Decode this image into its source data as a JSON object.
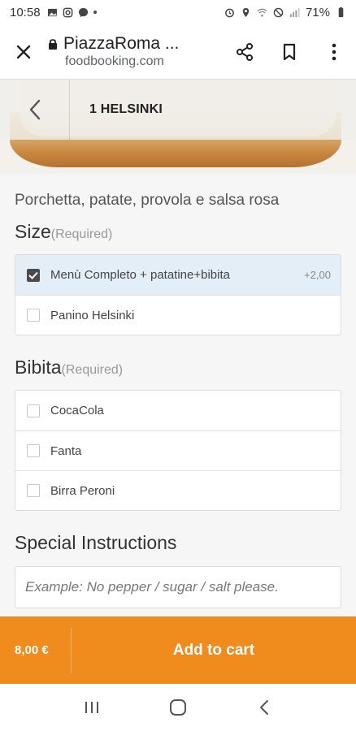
{
  "status_bar": {
    "time": "10:58",
    "battery": "71%",
    "left_icons": [
      "image-icon",
      "instagram-icon",
      "messenger-icon",
      "dot-icon"
    ],
    "right_icons": [
      "alarm-icon",
      "location-icon",
      "wifi-icon",
      "do-not-disturb-icon",
      "signal-icon",
      "battery-icon"
    ]
  },
  "browser": {
    "page_title": "PiazzaRoma ...",
    "domain": "foodbooking.com",
    "icons": [
      "close-icon",
      "lock-icon",
      "share-icon",
      "bookmark-icon",
      "more-vert-icon"
    ]
  },
  "item": {
    "title": "1 HELSINKI",
    "description": "Porchetta, patate, provola e salsa rosa"
  },
  "size_group": {
    "title": "Size",
    "required_label": "(Required)",
    "options": [
      {
        "label": "Menù Completo + patatine+bibita",
        "price": "+2,00",
        "checked": true
      },
      {
        "label": "Panino Helsinki",
        "price": "",
        "checked": false
      }
    ]
  },
  "drink_group": {
    "title": "Bibita",
    "required_label": "(Required)",
    "options": [
      {
        "label": "CocaCola",
        "checked": false
      },
      {
        "label": "Fanta",
        "checked": false
      },
      {
        "label": "Birra Peroni",
        "checked": false
      }
    ]
  },
  "special": {
    "title": "Special Instructions",
    "placeholder": "Example: No pepper / sugar / salt please.",
    "value": ""
  },
  "cart": {
    "price": "8,00 €",
    "button_label": "Add to cart"
  },
  "colors": {
    "accent": "#f08b1d",
    "selected_row": "#e4eef6"
  },
  "navbar": {
    "icons": [
      "recent-apps-icon",
      "home-icon",
      "back-icon"
    ]
  }
}
